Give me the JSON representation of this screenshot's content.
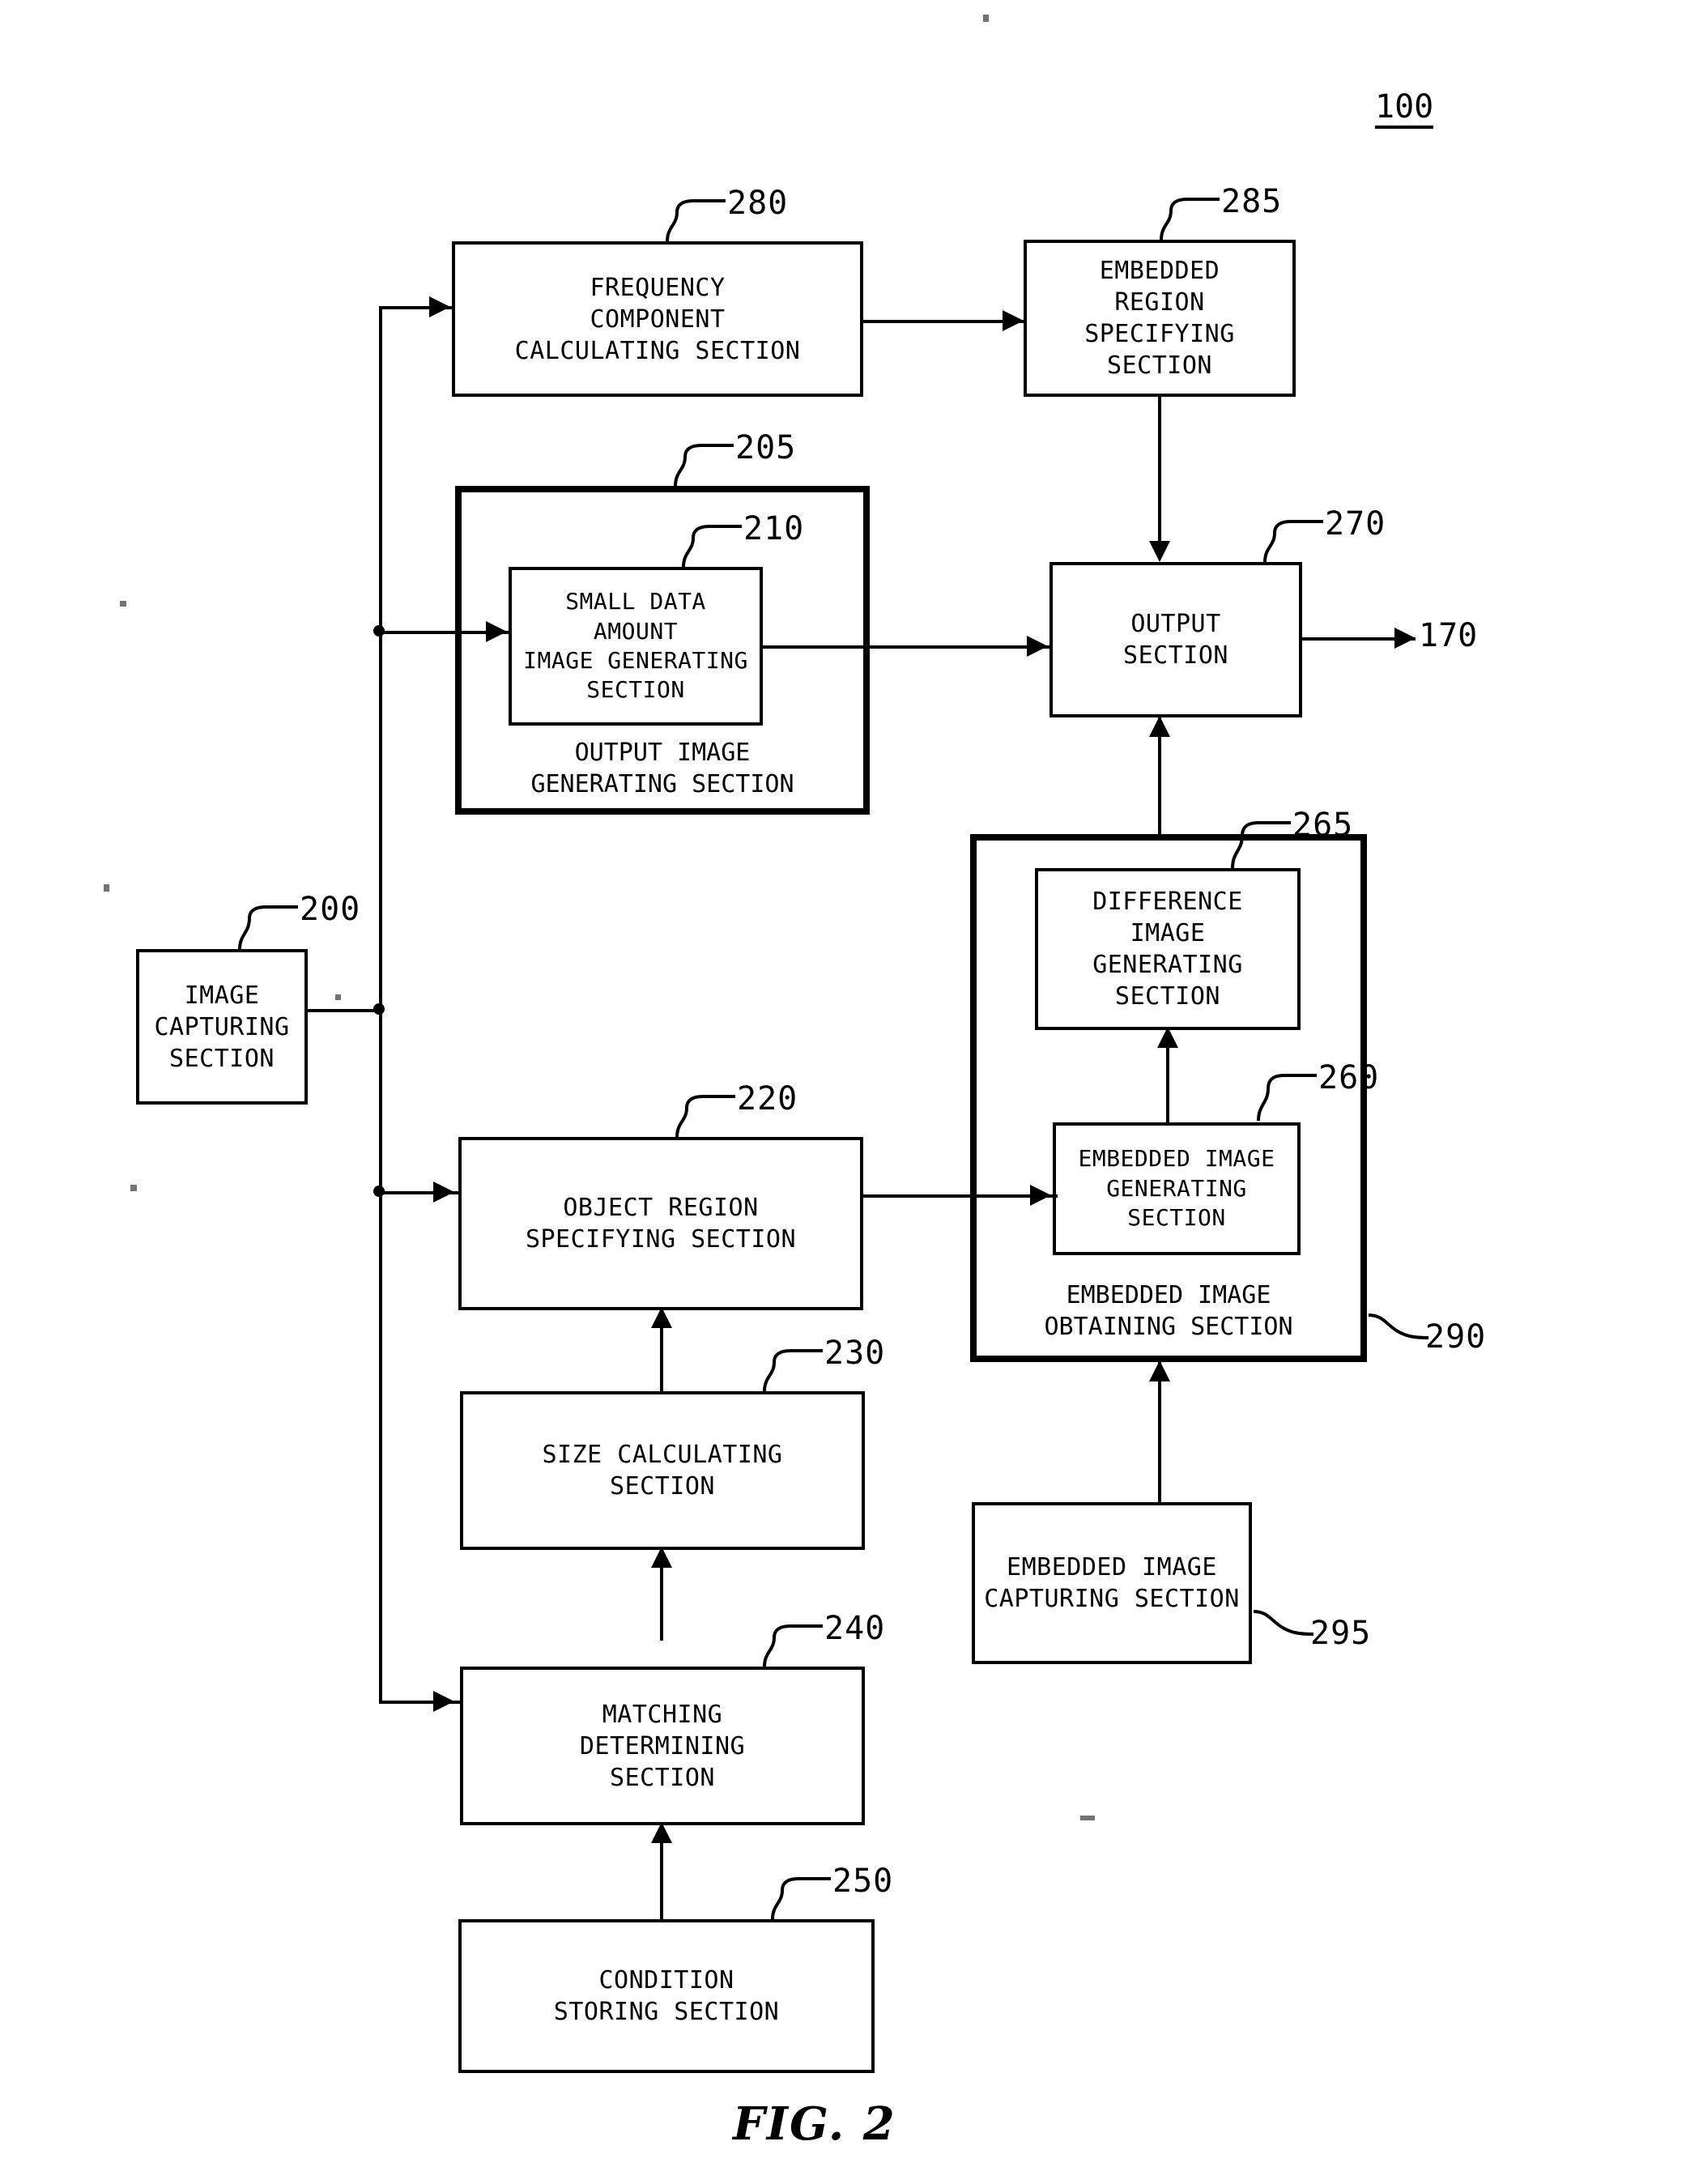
{
  "figure": {
    "title": "FIG. 2",
    "system_reference": "100"
  },
  "blocks": [
    {
      "id": "280",
      "label": "FREQUENCY\nCOMPONENT\nCALCULATING SECTION"
    },
    {
      "id": "285",
      "label": "EMBEDDED\nREGION\nSPECIFYING\nSECTION"
    },
    {
      "id": "205",
      "label": "OUTPUT IMAGE\nGENERATING SECTION"
    },
    {
      "id": "210",
      "label": "SMALL DATA\nAMOUNT\nIMAGE GENERATING\nSECTION"
    },
    {
      "id": "270",
      "label": "OUTPUT\nSECTION"
    },
    {
      "id": "265",
      "label": "DIFFERENCE\nIMAGE\nGENERATING\nSECTION"
    },
    {
      "id": "260",
      "label": "EMBEDDED IMAGE\nGENERATING\nSECTION"
    },
    {
      "id": "290",
      "label": "EMBEDDED IMAGE\nOBTAINING SECTION"
    },
    {
      "id": "295",
      "label": "EMBEDDED IMAGE\nCAPTURING SECTION"
    },
    {
      "id": "200",
      "label": "IMAGE\nCAPTURING\nSECTION"
    },
    {
      "id": "220",
      "label": "OBJECT REGION\nSPECIFYING SECTION"
    },
    {
      "id": "230",
      "label": "SIZE CALCULATING\nSECTION"
    },
    {
      "id": "240",
      "label": "MATCHING\nDETERMINING\nSECTION"
    },
    {
      "id": "250",
      "label": "CONDITION\nSTORING SECTION"
    }
  ],
  "terminals": [
    {
      "id": "170",
      "label": "170"
    }
  ],
  "colors": {
    "ink": "#000000",
    "paper": "#ffffff"
  }
}
